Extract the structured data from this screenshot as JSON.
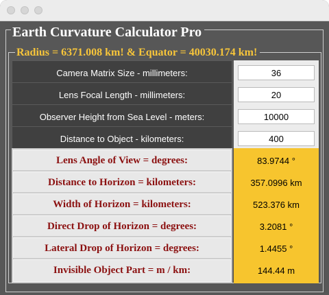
{
  "window": {
    "title": "Earth Curvature Calculator Pro",
    "subtitle": "Radius = 6371.008 km!  &  Equator = 40030.174 km!"
  },
  "inputs": [
    {
      "label": "Camera Matrix Size - millimeters:",
      "value": "36"
    },
    {
      "label": "Lens Focal Length - millimeters:",
      "value": "20"
    },
    {
      "label": "Observer Height from Sea Level - meters:",
      "value": "10000"
    },
    {
      "label": "Distance to Object - kilometers:",
      "value": "400"
    }
  ],
  "results": [
    {
      "label": "Lens Angle of View = degrees:",
      "value": "83.9744 °"
    },
    {
      "label": "Distance to Horizon = kilometers:",
      "value": "357.0996 km"
    },
    {
      "label": "Width of Horizon = kilometers:",
      "value": "523.376 km"
    },
    {
      "label": "Direct Drop of Horizon = degrees:",
      "value": "3.2081 °"
    },
    {
      "label": "Lateral Drop of Horizon = degrees:",
      "value": "1.4455 °"
    },
    {
      "label": "Invisible Object Part = m / km:",
      "value": "144.44 m"
    }
  ],
  "colors": {
    "background": "#575757",
    "title_text": "#ffffff",
    "subtitle_text": "#f7c53a",
    "input_label_bg": "#404040",
    "result_label_text": "#8b1010",
    "result_value_bg": "#f7c52e"
  }
}
